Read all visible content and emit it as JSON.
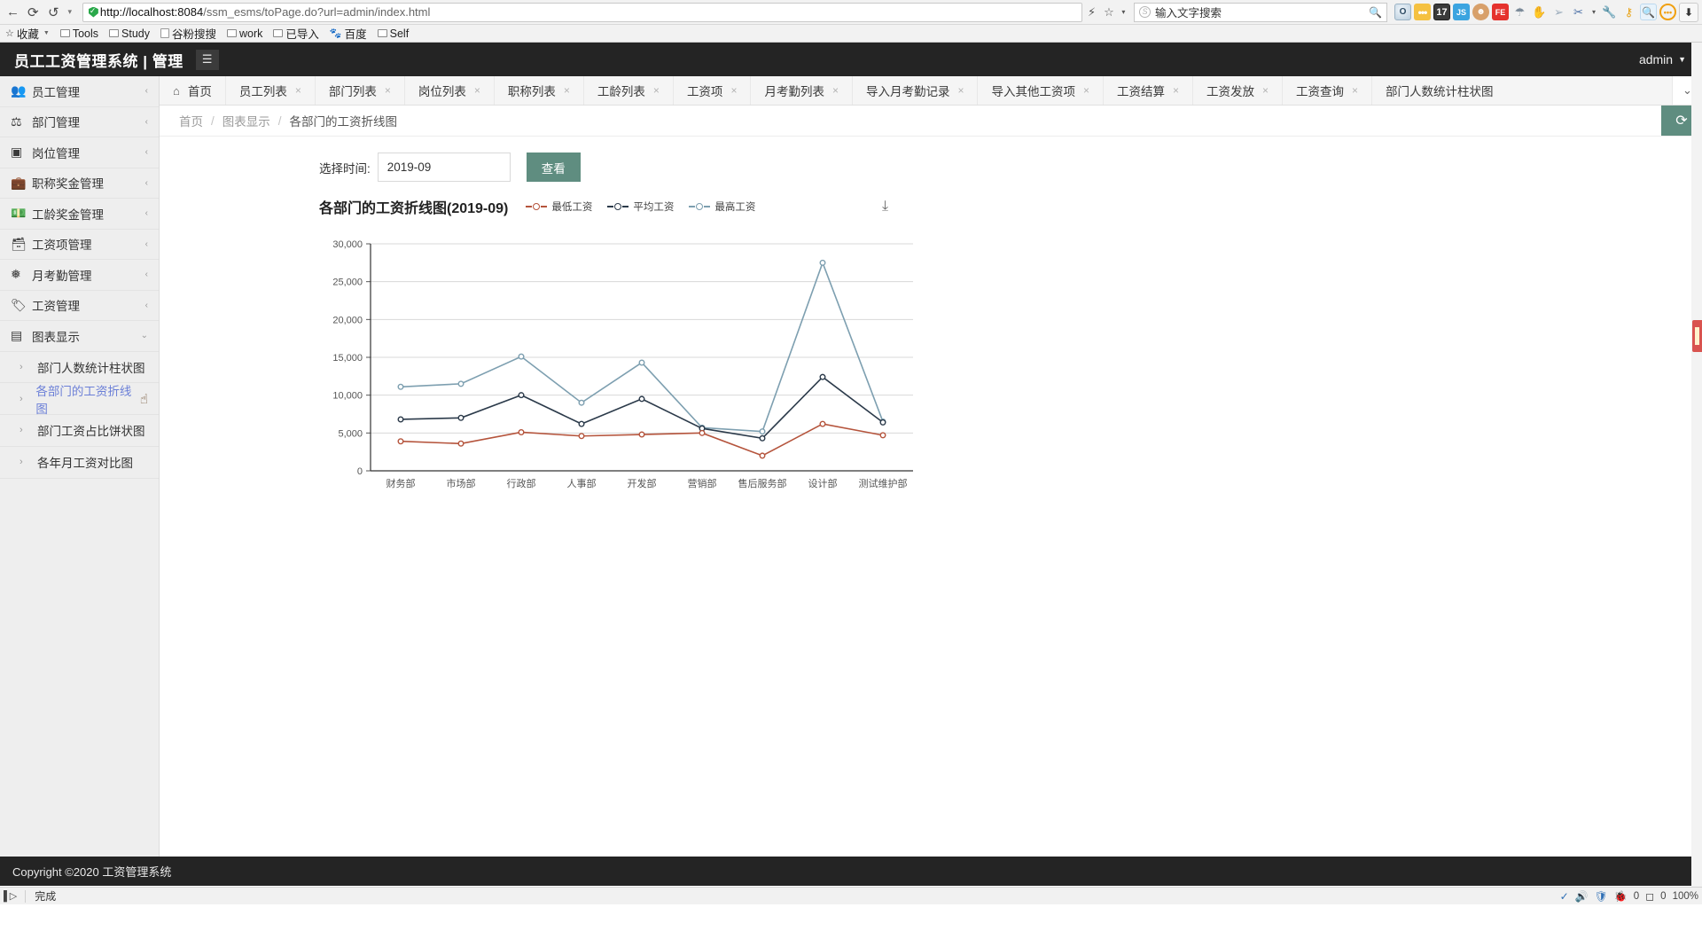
{
  "browser": {
    "back_icon": "←",
    "reload_icon": "⟳",
    "history_icon": "↺",
    "dropdown_icon": "▾",
    "url_host": "http://localhost:8084",
    "url_path": "/ssm_esms/toPage.do?url=admin/index.html",
    "lightning_icon": "⚡",
    "star_icon": "☆",
    "star_caret_icon": "▾",
    "search_placeholder": "输入文字搜索",
    "search_value": "输入文字搜索",
    "search_icon": "search-icon",
    "extensions": [
      {
        "name": "opera-icon",
        "label": "O"
      },
      {
        "name": "yellow-dots-icon",
        "label": "•••"
      },
      {
        "name": "counter-badge-icon",
        "label": "17"
      },
      {
        "name": "js-icon",
        "label": "JS"
      },
      {
        "name": "monkey-icon",
        "label": "🐵"
      },
      {
        "name": "fe-icon",
        "label": "FE"
      },
      {
        "name": "parachute-icon",
        "label": "☂"
      },
      {
        "name": "hand-icon",
        "label": "✋"
      },
      {
        "name": "cursor-icon",
        "label": "➤"
      },
      {
        "name": "scissors-icon",
        "label": "✂"
      },
      {
        "name": "wrench-icon",
        "label": "🔧"
      },
      {
        "name": "key-icon",
        "label": "🔑"
      },
      {
        "name": "magnifier-icon",
        "label": "🔍"
      },
      {
        "name": "more-icon",
        "label": "•••"
      },
      {
        "name": "download-icon",
        "label": "⬇"
      }
    ],
    "bookmarks": [
      {
        "label": "收藏",
        "icon": "star-icon",
        "caret": "▾"
      },
      {
        "label": "Tools",
        "icon": "folder-icon"
      },
      {
        "label": "Study",
        "icon": "folder-icon"
      },
      {
        "label": "谷粉搜搜",
        "icon": "page-icon"
      },
      {
        "label": "work",
        "icon": "folder-icon"
      },
      {
        "label": "已导入",
        "icon": "folder-icon"
      },
      {
        "label": "百度",
        "icon": "baidu-icon"
      },
      {
        "label": "Self",
        "icon": "folder-icon"
      }
    ]
  },
  "header": {
    "title": "员工工资管理系统 | 管理",
    "menu_icon": "☰",
    "user": "admin",
    "user_caret": "▾"
  },
  "sidebar": {
    "items": [
      {
        "label": "员工管理",
        "icon": "users-icon",
        "glyph": "👥",
        "arrow": "‹"
      },
      {
        "label": "部门管理",
        "icon": "sitemap-icon",
        "glyph": "⛓",
        "arrow": "‹"
      },
      {
        "label": "岗位管理",
        "icon": "id-badge-icon",
        "glyph": "▣",
        "arrow": "‹"
      },
      {
        "label": "职称奖金管理",
        "icon": "briefcase-icon",
        "glyph": "💼",
        "arrow": "‹"
      },
      {
        "label": "工龄奖金管理",
        "icon": "money-icon",
        "glyph": "💵",
        "arrow": "‹"
      },
      {
        "label": "工资项管理",
        "icon": "cash-card-icon",
        "glyph": "🗃",
        "arrow": "‹"
      },
      {
        "label": "月考勤管理",
        "icon": "layers-icon",
        "glyph": "≋",
        "arrow": "‹"
      },
      {
        "label": "工资管理",
        "icon": "tag-icon",
        "glyph": "🏷",
        "arrow": "‹"
      },
      {
        "label": "图表显示",
        "icon": "chart-icon",
        "glyph": "▤",
        "arrow": "⌄",
        "open": true
      }
    ],
    "sub_items": [
      {
        "label": "部门人数统计柱状图",
        "arrow": "›",
        "active": false
      },
      {
        "label": "各部门的工资折线图",
        "arrow": "›",
        "active": true
      },
      {
        "label": "部门工资占比饼状图",
        "arrow": "›",
        "active": false
      },
      {
        "label": "各年月工资对比图",
        "arrow": "›",
        "active": false
      }
    ],
    "cursor_icon": "pointer-hand-icon"
  },
  "tabs": {
    "home_icon": "home-icon",
    "close_icon": "×",
    "overflow_icon": "⌄",
    "items": [
      {
        "label": "首页",
        "closable": false,
        "home": true
      },
      {
        "label": "员工列表",
        "closable": true
      },
      {
        "label": "部门列表",
        "closable": true
      },
      {
        "label": "岗位列表",
        "closable": true
      },
      {
        "label": "职称列表",
        "closable": true
      },
      {
        "label": "工龄列表",
        "closable": true
      },
      {
        "label": "工资项",
        "closable": true
      },
      {
        "label": "月考勤列表",
        "closable": true
      },
      {
        "label": "导入月考勤记录",
        "closable": true
      },
      {
        "label": "导入其他工资项",
        "closable": true
      },
      {
        "label": "工资结算",
        "closable": true
      },
      {
        "label": "工资发放",
        "closable": true
      },
      {
        "label": "工资查询",
        "closable": true
      },
      {
        "label": "部门人数统计柱状图",
        "closable": false
      }
    ]
  },
  "breadcrumb": {
    "items": [
      "首页",
      "图表显示",
      "各部门的工资折线图"
    ],
    "separator": "/",
    "refresh_icon": "⟳"
  },
  "form": {
    "label": "选择时间:",
    "time_value": "2019-09",
    "time_placeholder": "2019-09",
    "view_button": "查看"
  },
  "chart_panel": {
    "download_icon": "⤓"
  },
  "chart_data": {
    "type": "line",
    "title": "各部门的工资折线图(2019-09)",
    "xlabel": "",
    "ylabel": "",
    "ylim": [
      0,
      30000
    ],
    "yticks": [
      0,
      5000,
      10000,
      15000,
      20000,
      25000,
      30000
    ],
    "ytick_labels": [
      "0",
      "5,000",
      "10,000",
      "15,000",
      "20,000",
      "25,000",
      "30,000"
    ],
    "grid": true,
    "legend_position": "top",
    "categories": [
      "财务部",
      "市场部",
      "行政部",
      "人事部",
      "开发部",
      "营销部",
      "售后服务部",
      "设计部",
      "测试维护部"
    ],
    "series": [
      {
        "name": "最低工资",
        "color": "#b5543c",
        "values": [
          3900,
          3600,
          5100,
          4600,
          4800,
          5000,
          2000,
          6200,
          4700
        ]
      },
      {
        "name": "平均工资",
        "color": "#2b3a4a",
        "values": [
          6800,
          7000,
          10000,
          6200,
          9500,
          5600,
          4300,
          12400,
          6400
        ]
      },
      {
        "name": "最高工资",
        "color": "#7d9fb0",
        "values": [
          11100,
          11500,
          15100,
          9000,
          14300,
          5700,
          5200,
          27500,
          6500
        ]
      }
    ]
  },
  "footer": {
    "text": "Copyright ©2020 工资管理系统"
  },
  "statusbar": {
    "play_icon": "▷",
    "status_text": "完成",
    "icons": [
      "check-icon",
      "speaker-icon",
      "shield-icon",
      "bug-icon"
    ],
    "mem1": "0",
    "mem2": "0",
    "zoom": "100%"
  }
}
